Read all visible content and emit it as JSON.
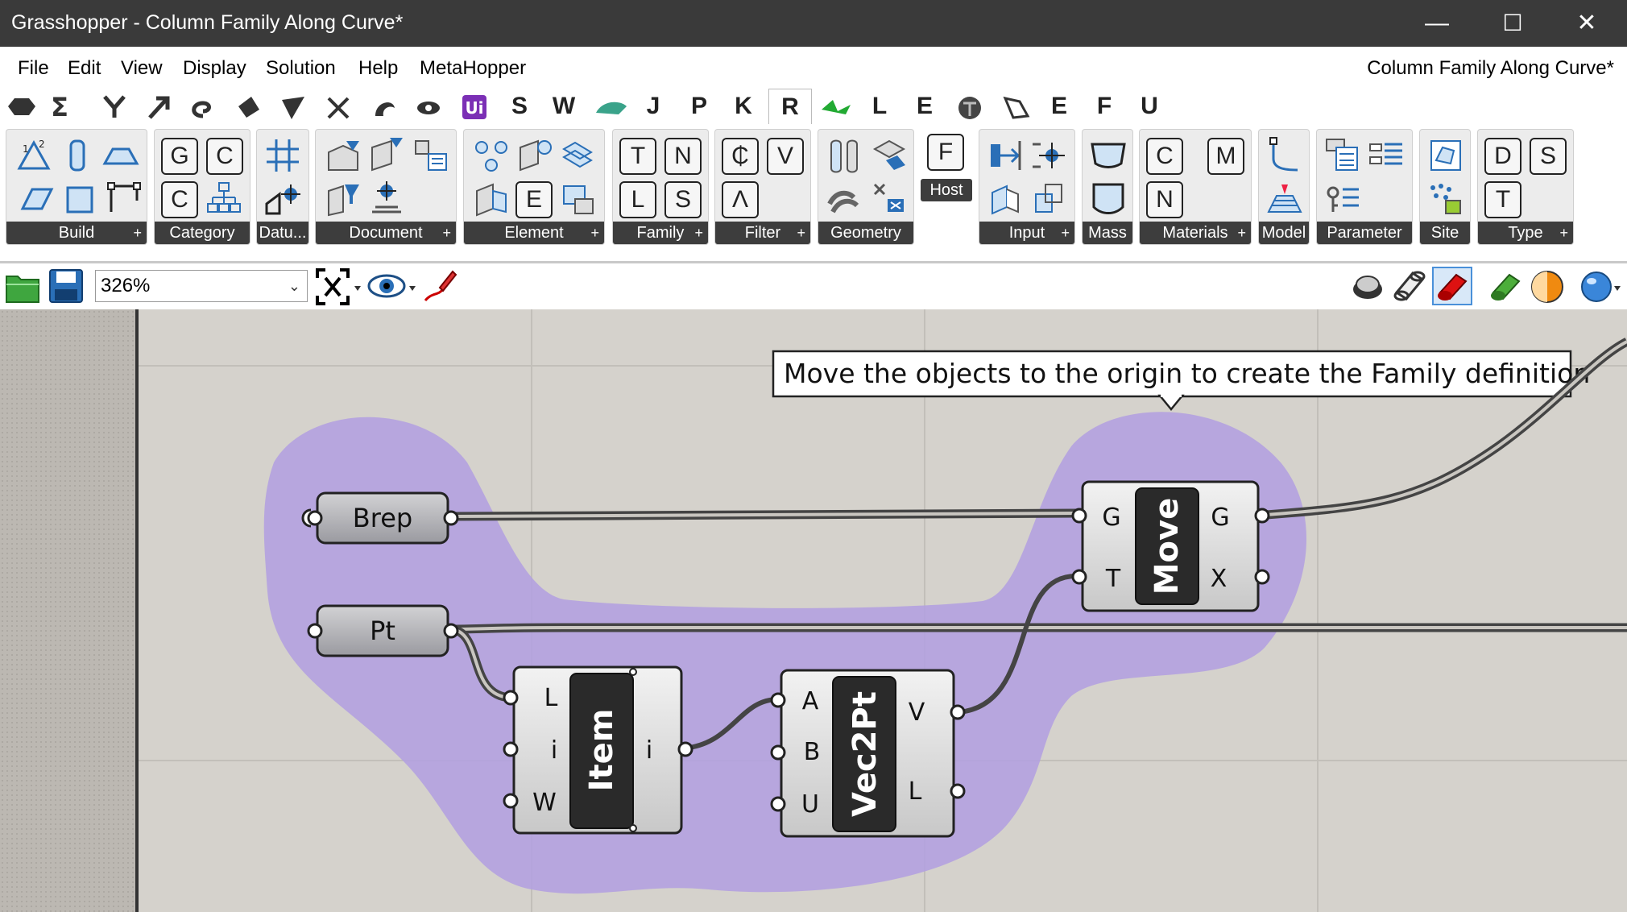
{
  "window": {
    "title": "Grasshopper - Column Family Along Curve*",
    "controls": [
      "—",
      "☐",
      "✕"
    ]
  },
  "menubar": {
    "items": [
      "File",
      "Edit",
      "View",
      "Display",
      "Solution",
      "Help",
      "MetaHopper"
    ],
    "document_title": "Column Family Along Curve*"
  },
  "tabs": {
    "text_tabs": [
      "S",
      "W",
      "J",
      "P",
      "K",
      "R",
      "L",
      "E",
      "E",
      "F",
      "U"
    ],
    "active": "R"
  },
  "ribbon": {
    "panels": [
      {
        "label": "Build"
      },
      {
        "label": "Category",
        "buttons": [
          "G",
          "C",
          "C"
        ]
      },
      {
        "label": "Datu..."
      },
      {
        "label": "Document"
      },
      {
        "label": "Element",
        "buttons": [
          "E"
        ]
      },
      {
        "label": "Family",
        "buttons": [
          "T",
          "N",
          "L",
          "S"
        ]
      },
      {
        "label": "Filter",
        "buttons": [
          "₵",
          "V",
          "Λ"
        ]
      },
      {
        "label": "Geometry"
      },
      {
        "label": "Host",
        "buttons": [
          "F"
        ]
      },
      {
        "label": "Input"
      },
      {
        "label": "Mass"
      },
      {
        "label": "Materials",
        "buttons": [
          "C",
          "M",
          "N"
        ]
      },
      {
        "label": "Model"
      },
      {
        "label": "Parameter"
      },
      {
        "label": "Site"
      },
      {
        "label": "Type",
        "buttons": [
          "D",
          "S",
          "T"
        ]
      }
    ],
    "expand_glyph": "+"
  },
  "toolbar": {
    "zoom_value": "326%"
  },
  "canvas": {
    "tooltip": "Move the objects to the origin to create the Family definition",
    "params": {
      "brep": "Brep",
      "pt": "Pt"
    },
    "components": {
      "move": {
        "name": "Move",
        "inputs": [
          "G",
          "T"
        ],
        "outputs": [
          "G",
          "X"
        ]
      },
      "item": {
        "name": "Item",
        "inputs": [
          "L",
          "i",
          "W"
        ],
        "outputs": [
          "i"
        ]
      },
      "vec2pt": {
        "name": "Vec2Pt",
        "inputs": [
          "A",
          "B",
          "U"
        ],
        "outputs": [
          "V",
          "L"
        ]
      }
    },
    "colors": {
      "group_fill": "#b29fe0",
      "background": "#d5d2cc",
      "wire": "#3a3a3a"
    }
  }
}
